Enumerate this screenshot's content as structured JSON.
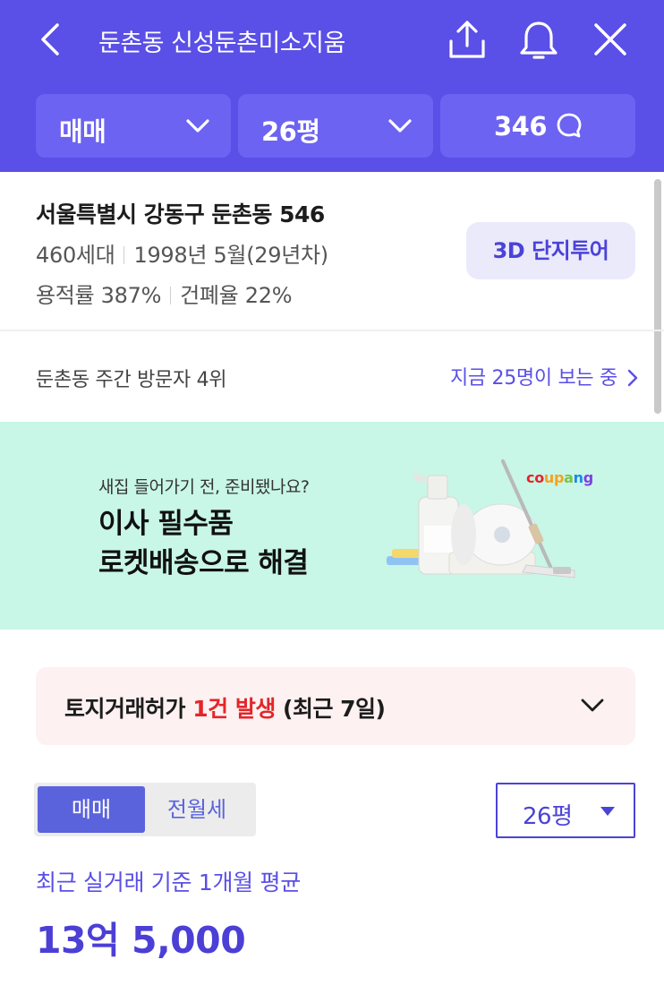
{
  "header": {
    "title": "둔촌동 신성둔촌미소지움",
    "filters": {
      "trade_type": "매매",
      "size": "26평",
      "comment_count": "346"
    }
  },
  "complex_info": {
    "address": "서울특별시 강동구 둔촌동 546",
    "households": "460세대",
    "built": "1998년 5월(29년차)",
    "floor_area_ratio": "용적률 387%",
    "building_coverage": "건폐율 22%",
    "tour_button": "3D 단지투어"
  },
  "visitors": {
    "rank_text": "둔촌동 주간 방문자 4위",
    "viewing_now": "지금 25명이 보는 중"
  },
  "ad": {
    "subtitle": "새집 들어가기 전, 준비됐나요?",
    "line1": "이사 필수품",
    "line2": "로켓배송으로 해결",
    "brand": "coupang",
    "brand_colors": [
      "#e2262a",
      "#f6a21e",
      "#7cc242",
      "#1e88e5",
      "#7b3fe4"
    ]
  },
  "land_permit": {
    "prefix": "토지거래허가 ",
    "highlight": "1건 발생",
    "suffix": " (최근 7일)"
  },
  "price_section": {
    "toggle_active": "매매",
    "toggle_inactive": "전월세",
    "size_select": "26평",
    "avg_label": "최근 실거래 기준 1개월 평균",
    "avg_price": "13억 5,000"
  },
  "colors": {
    "brand": "#5a4fe6",
    "filter_bg": "#6c63f2",
    "ad_bg": "#c8f6e7",
    "permit_bg": "#fdf1f1",
    "alert_red": "#e2262a"
  }
}
